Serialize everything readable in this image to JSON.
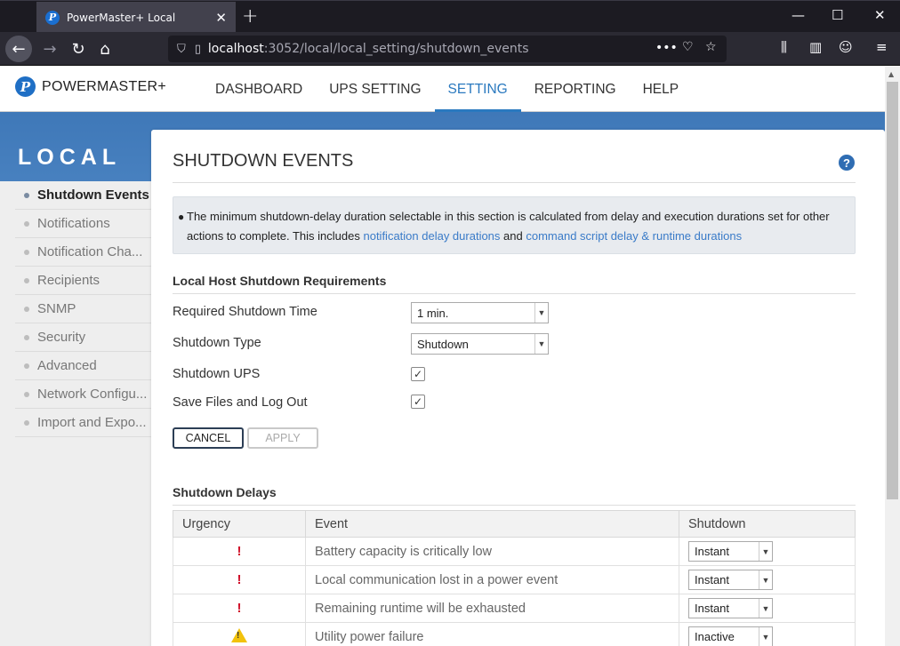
{
  "browser": {
    "tab_title": "PowerMaster+ Local",
    "url_host": "localhost",
    "url_path": ":3052/local/local_setting/shutdown_events"
  },
  "header": {
    "logo_text": "POWERMASTER+",
    "nav": [
      "DASHBOARD",
      "UPS SETTING",
      "SETTING",
      "REPORTING",
      "HELP"
    ],
    "active_nav": "SETTING"
  },
  "sidebar": {
    "title": "LOCAL",
    "items": [
      {
        "label": "Shutdown Events"
      },
      {
        "label": "Notifications"
      },
      {
        "label": "Notification Cha..."
      },
      {
        "label": "Recipients"
      },
      {
        "label": "SNMP"
      },
      {
        "label": "Security"
      },
      {
        "label": "Advanced"
      },
      {
        "label": "Network Configu..."
      },
      {
        "label": "Import and Expo..."
      }
    ]
  },
  "main": {
    "title": "SHUTDOWN EVENTS",
    "note": {
      "text1": "The minimum shutdown-delay duration selectable in this section is calculated from delay and execution durations set for other actions to complete. This includes ",
      "link1": "notification delay durations",
      "and": " and ",
      "link2": "command script delay & runtime durations"
    },
    "requirements": {
      "title": "Local Host Shutdown Requirements",
      "required_time_label": "Required Shutdown Time",
      "required_time_value": "1 min.",
      "shutdown_type_label": "Shutdown Type",
      "shutdown_type_value": "Shutdown",
      "shutdown_ups_label": "Shutdown UPS",
      "save_files_label": "Save Files and Log Out"
    },
    "buttons": {
      "cancel": "CANCEL",
      "apply": "APPLY"
    },
    "delays": {
      "title": "Shutdown Delays",
      "headers": [
        "Urgency",
        "Event",
        "Shutdown"
      ],
      "rows": [
        {
          "urgency": "critical",
          "event": "Battery capacity is critically low",
          "shutdown": "Instant"
        },
        {
          "urgency": "critical",
          "event": "Local communication lost in a power event",
          "shutdown": "Instant"
        },
        {
          "urgency": "critical",
          "event": "Remaining runtime will be exhausted",
          "shutdown": "Instant"
        },
        {
          "urgency": "warning",
          "event": "Utility power failure",
          "shutdown": "Inactive"
        }
      ]
    }
  },
  "colors": {
    "accent": "#2a79bf",
    "band": "#4a83c2",
    "critical": "#d0102a",
    "warning": "#f2c20c"
  }
}
